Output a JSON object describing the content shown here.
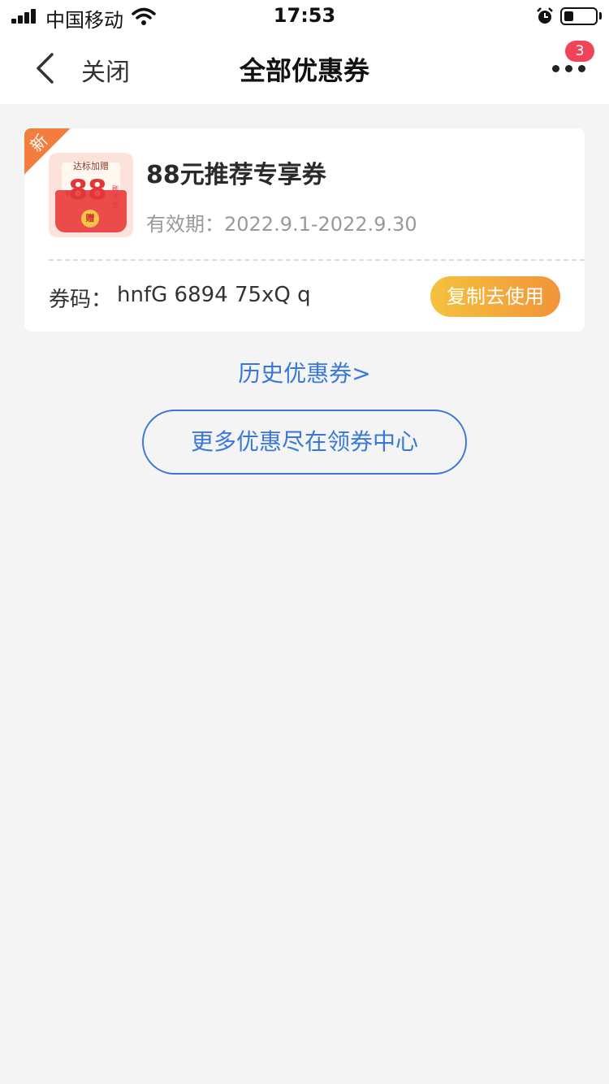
{
  "status_bar": {
    "carrier": "中国移动",
    "time": "17:53",
    "icons": [
      "signal-icon",
      "wifi-icon",
      "alarm-icon",
      "battery-icon"
    ],
    "battery_level": 0.3
  },
  "nav": {
    "close_label": "关闭",
    "title": "全部优惠券",
    "more_badge": "3",
    "icons": [
      "back-arrow-icon",
      "more-dots-icon"
    ]
  },
  "coupon": {
    "new_tag": "新",
    "thumbnail": {
      "top_text": "达标加赠",
      "currency": "¥",
      "amount": "88",
      "side_text": "刷卡金",
      "seal": "赠"
    },
    "title": "88元推荐专享券",
    "validity": "有效期：2022.9.1-2022.9.30",
    "code_label": "券码：",
    "code_value": "hnfG 6894 75xQ q",
    "copy_button": "复制去使用"
  },
  "history_link": "历史优惠券>",
  "more_button": "更多优惠尽在领券中心",
  "colors": {
    "accent_blue": "#3a78d8",
    "badge_red": "#f0445a",
    "new_tag_orange": "#f27d3d",
    "copy_button_gradient": [
      "#f5c23c",
      "#f2943a"
    ],
    "background": "#f4f4f4"
  }
}
